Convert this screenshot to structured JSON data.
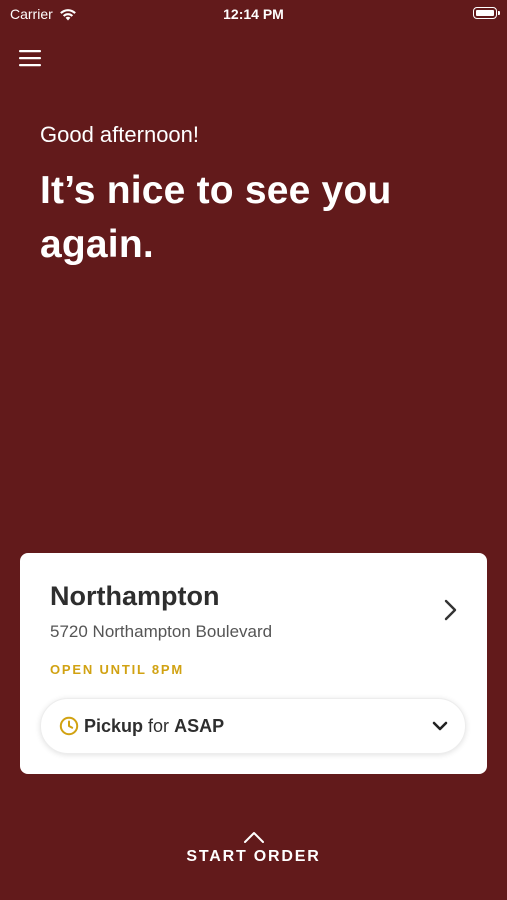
{
  "status_bar": {
    "carrier": "Carrier",
    "time": "12:14 PM"
  },
  "greeting": "Good afternoon!",
  "headline": "It’s nice to see you again.",
  "store": {
    "name": "Northampton",
    "address": "5720 Northampton Boulevard",
    "hours": "OPEN UNTIL 8PM"
  },
  "pickup": {
    "mode": "Pickup",
    "connector": "for",
    "time": "ASAP"
  },
  "start_order": "START ORDER",
  "colors": {
    "background": "#621a1b",
    "accent": "#d1a212",
    "card": "#ffffff"
  },
  "icons": [
    "wifi-icon",
    "battery-icon",
    "menu-icon",
    "chevron-right-icon",
    "clock-icon",
    "chevron-down-icon",
    "chevron-up-icon"
  ]
}
